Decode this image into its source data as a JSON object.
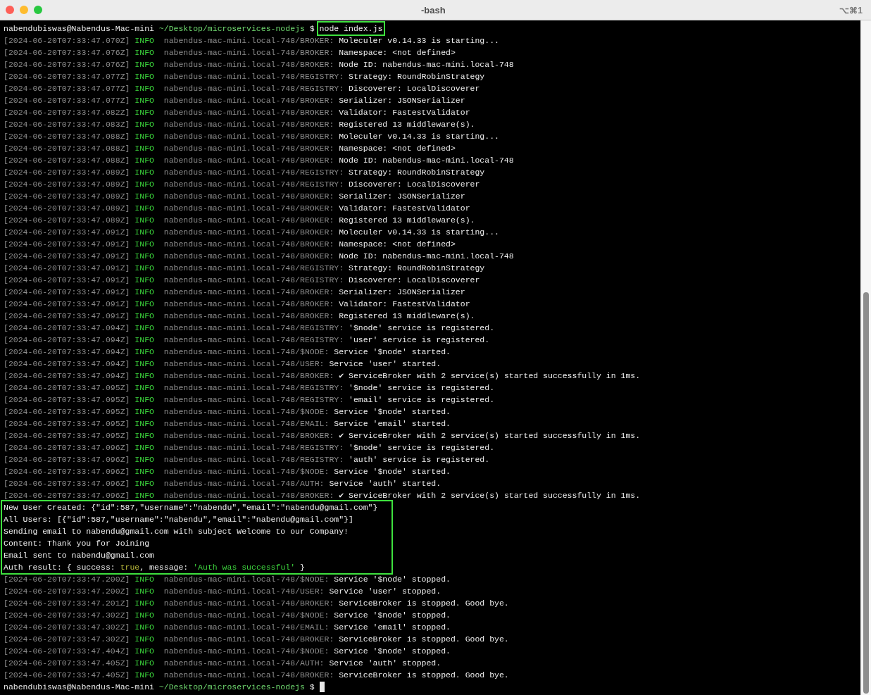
{
  "window": {
    "title": "-bash",
    "shortcut": "⌥⌘1"
  },
  "prompt_top": {
    "user": "nabendubiswas@Nabendus-Mac-mini",
    "path": "~/Desktop/microservices-nodejs",
    "symbol": "$",
    "command": "node index.js",
    "highlighted": true
  },
  "log_start": [
    {
      "timestamp": "[2024-06-20T07:33:47.070Z]",
      "level": "INFO",
      "source": "nabendus-mac-mini.local-748/BROKER:",
      "message": "Moleculer v0.14.33 is starting..."
    },
    {
      "timestamp": "[2024-06-20T07:33:47.076Z]",
      "level": "INFO",
      "source": "nabendus-mac-mini.local-748/BROKER:",
      "message": "Namespace: <not defined>"
    },
    {
      "timestamp": "[2024-06-20T07:33:47.076Z]",
      "level": "INFO",
      "source": "nabendus-mac-mini.local-748/BROKER:",
      "message": "Node ID: nabendus-mac-mini.local-748"
    },
    {
      "timestamp": "[2024-06-20T07:33:47.077Z]",
      "level": "INFO",
      "source": "nabendus-mac-mini.local-748/REGISTRY:",
      "message": "Strategy: RoundRobinStrategy"
    },
    {
      "timestamp": "[2024-06-20T07:33:47.077Z]",
      "level": "INFO",
      "source": "nabendus-mac-mini.local-748/REGISTRY:",
      "message": "Discoverer: LocalDiscoverer"
    },
    {
      "timestamp": "[2024-06-20T07:33:47.077Z]",
      "level": "INFO",
      "source": "nabendus-mac-mini.local-748/BROKER:",
      "message": "Serializer: JSONSerializer"
    },
    {
      "timestamp": "[2024-06-20T07:33:47.082Z]",
      "level": "INFO",
      "source": "nabendus-mac-mini.local-748/BROKER:",
      "message": "Validator: FastestValidator"
    },
    {
      "timestamp": "[2024-06-20T07:33:47.083Z]",
      "level": "INFO",
      "source": "nabendus-mac-mini.local-748/BROKER:",
      "message": "Registered 13 middleware(s)."
    },
    {
      "timestamp": "[2024-06-20T07:33:47.088Z]",
      "level": "INFO",
      "source": "nabendus-mac-mini.local-748/BROKER:",
      "message": "Moleculer v0.14.33 is starting..."
    },
    {
      "timestamp": "[2024-06-20T07:33:47.088Z]",
      "level": "INFO",
      "source": "nabendus-mac-mini.local-748/BROKER:",
      "message": "Namespace: <not defined>"
    },
    {
      "timestamp": "[2024-06-20T07:33:47.088Z]",
      "level": "INFO",
      "source": "nabendus-mac-mini.local-748/BROKER:",
      "message": "Node ID: nabendus-mac-mini.local-748"
    },
    {
      "timestamp": "[2024-06-20T07:33:47.089Z]",
      "level": "INFO",
      "source": "nabendus-mac-mini.local-748/REGISTRY:",
      "message": "Strategy: RoundRobinStrategy"
    },
    {
      "timestamp": "[2024-06-20T07:33:47.089Z]",
      "level": "INFO",
      "source": "nabendus-mac-mini.local-748/REGISTRY:",
      "message": "Discoverer: LocalDiscoverer"
    },
    {
      "timestamp": "[2024-06-20T07:33:47.089Z]",
      "level": "INFO",
      "source": "nabendus-mac-mini.local-748/BROKER:",
      "message": "Serializer: JSONSerializer"
    },
    {
      "timestamp": "[2024-06-20T07:33:47.089Z]",
      "level": "INFO",
      "source": "nabendus-mac-mini.local-748/BROKER:",
      "message": "Validator: FastestValidator"
    },
    {
      "timestamp": "[2024-06-20T07:33:47.089Z]",
      "level": "INFO",
      "source": "nabendus-mac-mini.local-748/BROKER:",
      "message": "Registered 13 middleware(s)."
    },
    {
      "timestamp": "[2024-06-20T07:33:47.091Z]",
      "level": "INFO",
      "source": "nabendus-mac-mini.local-748/BROKER:",
      "message": "Moleculer v0.14.33 is starting..."
    },
    {
      "timestamp": "[2024-06-20T07:33:47.091Z]",
      "level": "INFO",
      "source": "nabendus-mac-mini.local-748/BROKER:",
      "message": "Namespace: <not defined>"
    },
    {
      "timestamp": "[2024-06-20T07:33:47.091Z]",
      "level": "INFO",
      "source": "nabendus-mac-mini.local-748/BROKER:",
      "message": "Node ID: nabendus-mac-mini.local-748"
    },
    {
      "timestamp": "[2024-06-20T07:33:47.091Z]",
      "level": "INFO",
      "source": "nabendus-mac-mini.local-748/REGISTRY:",
      "message": "Strategy: RoundRobinStrategy"
    },
    {
      "timestamp": "[2024-06-20T07:33:47.091Z]",
      "level": "INFO",
      "source": "nabendus-mac-mini.local-748/REGISTRY:",
      "message": "Discoverer: LocalDiscoverer"
    },
    {
      "timestamp": "[2024-06-20T07:33:47.091Z]",
      "level": "INFO",
      "source": "nabendus-mac-mini.local-748/BROKER:",
      "message": "Serializer: JSONSerializer"
    },
    {
      "timestamp": "[2024-06-20T07:33:47.091Z]",
      "level": "INFO",
      "source": "nabendus-mac-mini.local-748/BROKER:",
      "message": "Validator: FastestValidator"
    },
    {
      "timestamp": "[2024-06-20T07:33:47.091Z]",
      "level": "INFO",
      "source": "nabendus-mac-mini.local-748/BROKER:",
      "message": "Registered 13 middleware(s)."
    },
    {
      "timestamp": "[2024-06-20T07:33:47.094Z]",
      "level": "INFO",
      "source": "nabendus-mac-mini.local-748/REGISTRY:",
      "message": "'$node' service is registered."
    },
    {
      "timestamp": "[2024-06-20T07:33:47.094Z]",
      "level": "INFO",
      "source": "nabendus-mac-mini.local-748/REGISTRY:",
      "message": "'user' service is registered."
    },
    {
      "timestamp": "[2024-06-20T07:33:47.094Z]",
      "level": "INFO",
      "source": "nabendus-mac-mini.local-748/$NODE:",
      "message": "Service '$node' started."
    },
    {
      "timestamp": "[2024-06-20T07:33:47.094Z]",
      "level": "INFO",
      "source": "nabendus-mac-mini.local-748/USER:",
      "message": "Service 'user' started."
    },
    {
      "timestamp": "[2024-06-20T07:33:47.094Z]",
      "level": "INFO",
      "source": "nabendus-mac-mini.local-748/BROKER:",
      "message": "✔ ServiceBroker with 2 service(s) started successfully in 1ms."
    },
    {
      "timestamp": "[2024-06-20T07:33:47.095Z]",
      "level": "INFO",
      "source": "nabendus-mac-mini.local-748/REGISTRY:",
      "message": "'$node' service is registered."
    },
    {
      "timestamp": "[2024-06-20T07:33:47.095Z]",
      "level": "INFO",
      "source": "nabendus-mac-mini.local-748/REGISTRY:",
      "message": "'email' service is registered."
    },
    {
      "timestamp": "[2024-06-20T07:33:47.095Z]",
      "level": "INFO",
      "source": "nabendus-mac-mini.local-748/$NODE:",
      "message": "Service '$node' started."
    },
    {
      "timestamp": "[2024-06-20T07:33:47.095Z]",
      "level": "INFO",
      "source": "nabendus-mac-mini.local-748/EMAIL:",
      "message": "Service 'email' started."
    },
    {
      "timestamp": "[2024-06-20T07:33:47.095Z]",
      "level": "INFO",
      "source": "nabendus-mac-mini.local-748/BROKER:",
      "message": "✔ ServiceBroker with 2 service(s) started successfully in 1ms."
    },
    {
      "timestamp": "[2024-06-20T07:33:47.096Z]",
      "level": "INFO",
      "source": "nabendus-mac-mini.local-748/REGISTRY:",
      "message": "'$node' service is registered."
    },
    {
      "timestamp": "[2024-06-20T07:33:47.096Z]",
      "level": "INFO",
      "source": "nabendus-mac-mini.local-748/REGISTRY:",
      "message": "'auth' service is registered."
    },
    {
      "timestamp": "[2024-06-20T07:33:47.096Z]",
      "level": "INFO",
      "source": "nabendus-mac-mini.local-748/$NODE:",
      "message": "Service '$node' started."
    },
    {
      "timestamp": "[2024-06-20T07:33:47.096Z]",
      "level": "INFO",
      "source": "nabendus-mac-mini.local-748/AUTH:",
      "message": "Service 'auth' started."
    },
    {
      "timestamp": "[2024-06-20T07:33:47.096Z]",
      "level": "INFO",
      "source": "nabendus-mac-mini.local-748/BROKER:",
      "message": "✔ ServiceBroker with 2 service(s) started successfully in 1ms."
    }
  ],
  "output_block": {
    "highlighted": true,
    "lines": [
      {
        "segments": [
          {
            "kind": "plain",
            "text": "New User Created: {\"id\":587,\"username\":\"nabendu\",\"email\":\"nabendu@gmail.com\"}"
          }
        ]
      },
      {
        "segments": [
          {
            "kind": "plain",
            "text": "All Users: [{\"id\":587,\"username\":\"nabendu\",\"email\":\"nabendu@gmail.com\"}]"
          }
        ]
      },
      {
        "segments": [
          {
            "kind": "plain",
            "text": "Sending email to nabendu@gmail.com with subject Welcome to our Company!"
          }
        ]
      },
      {
        "segments": [
          {
            "kind": "plain",
            "text": "Content: Thank you for Joining"
          }
        ]
      },
      {
        "segments": [
          {
            "kind": "plain",
            "text": "Email sent to nabendu@gmail.com"
          }
        ]
      },
      {
        "segments": [
          {
            "kind": "plain",
            "text": "Auth result: { success: "
          },
          {
            "kind": "boolean",
            "text": "true"
          },
          {
            "kind": "plain",
            "text": ", message: "
          },
          {
            "kind": "string",
            "text": "'Auth was successful'"
          },
          {
            "kind": "plain",
            "text": " }"
          }
        ]
      }
    ]
  },
  "log_end": [
    {
      "timestamp": "[2024-06-20T07:33:47.200Z]",
      "level": "INFO",
      "source": "nabendus-mac-mini.local-748/$NODE:",
      "message": "Service '$node' stopped."
    },
    {
      "timestamp": "[2024-06-20T07:33:47.200Z]",
      "level": "INFO",
      "source": "nabendus-mac-mini.local-748/USER:",
      "message": "Service 'user' stopped."
    },
    {
      "timestamp": "[2024-06-20T07:33:47.201Z]",
      "level": "INFO",
      "source": "nabendus-mac-mini.local-748/BROKER:",
      "message": "ServiceBroker is stopped. Good bye."
    },
    {
      "timestamp": "[2024-06-20T07:33:47.302Z]",
      "level": "INFO",
      "source": "nabendus-mac-mini.local-748/$NODE:",
      "message": "Service '$node' stopped."
    },
    {
      "timestamp": "[2024-06-20T07:33:47.302Z]",
      "level": "INFO",
      "source": "nabendus-mac-mini.local-748/EMAIL:",
      "message": "Service 'email' stopped."
    },
    {
      "timestamp": "[2024-06-20T07:33:47.302Z]",
      "level": "INFO",
      "source": "nabendus-mac-mini.local-748/BROKER:",
      "message": "ServiceBroker is stopped. Good bye."
    },
    {
      "timestamp": "[2024-06-20T07:33:47.404Z]",
      "level": "INFO",
      "source": "nabendus-mac-mini.local-748/$NODE:",
      "message": "Service '$node' stopped."
    },
    {
      "timestamp": "[2024-06-20T07:33:47.405Z]",
      "level": "INFO",
      "source": "nabendus-mac-mini.local-748/AUTH:",
      "message": "Service 'auth' stopped."
    },
    {
      "timestamp": "[2024-06-20T07:33:47.405Z]",
      "level": "INFO",
      "source": "nabendus-mac-mini.local-748/BROKER:",
      "message": "ServiceBroker is stopped. Good bye."
    }
  ],
  "prompt_bottom": {
    "user": "nabendubiswas@Nabendus-Mac-mini",
    "path": "~/Desktop/microservices-nodejs",
    "symbol": "$",
    "cursor": true
  }
}
